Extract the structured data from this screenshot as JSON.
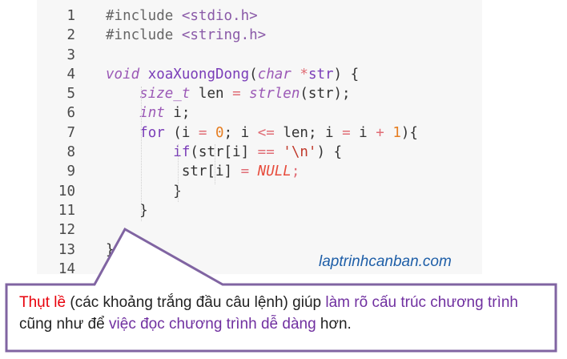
{
  "code_lines": [
    {
      "n": "1",
      "tokens": [
        {
          "t": "#include",
          "c": "dir"
        },
        {
          "t": " "
        },
        {
          "t": "<stdio.h>",
          "c": "inc"
        }
      ]
    },
    {
      "n": "2",
      "tokens": [
        {
          "t": "#include",
          "c": "dir"
        },
        {
          "t": " "
        },
        {
          "t": "<string.h>",
          "c": "inc"
        }
      ]
    },
    {
      "n": "3",
      "tokens": []
    },
    {
      "n": "4",
      "tokens": [
        {
          "t": "void",
          "c": "kw"
        },
        {
          "t": " "
        },
        {
          "t": "xoaXuongDong",
          "c": "fn"
        },
        {
          "t": "("
        },
        {
          "t": "char",
          "c": "kw"
        },
        {
          "t": " "
        },
        {
          "t": "*",
          "c": "op"
        },
        {
          "t": "str",
          "c": "fn"
        },
        {
          "t": ") {"
        }
      ]
    },
    {
      "n": "5",
      "tokens": [
        {
          "t": "    "
        },
        {
          "t": "size_t",
          "c": "kw"
        },
        {
          "t": " len "
        },
        {
          "t": "=",
          "c": "op"
        },
        {
          "t": " "
        },
        {
          "t": "strlen",
          "c": "kw"
        },
        {
          "t": "(str);"
        }
      ]
    },
    {
      "n": "6",
      "tokens": [
        {
          "t": "    "
        },
        {
          "t": "int",
          "c": "kw"
        },
        {
          "t": " i;"
        }
      ]
    },
    {
      "n": "7",
      "tokens": [
        {
          "t": "    "
        },
        {
          "t": "for",
          "c": "fn"
        },
        {
          "t": " (i "
        },
        {
          "t": "=",
          "c": "op"
        },
        {
          "t": " "
        },
        {
          "t": "0",
          "c": "num"
        },
        {
          "t": "; i "
        },
        {
          "t": "<=",
          "c": "op"
        },
        {
          "t": " len; i "
        },
        {
          "t": "=",
          "c": "op"
        },
        {
          "t": " i "
        },
        {
          "t": "+",
          "c": "op"
        },
        {
          "t": " "
        },
        {
          "t": "1",
          "c": "num"
        },
        {
          "t": "){"
        }
      ]
    },
    {
      "n": "8",
      "tokens": [
        {
          "t": "        "
        },
        {
          "t": "if",
          "c": "fn"
        },
        {
          "t": "(str[i] "
        },
        {
          "t": "==",
          "c": "op"
        },
        {
          "t": " "
        },
        {
          "t": "'\\n'",
          "c": "str"
        },
        {
          "t": ") {"
        }
      ]
    },
    {
      "n": "9",
      "tokens": [
        {
          "t": "         str[i] "
        },
        {
          "t": "=",
          "c": "op"
        },
        {
          "t": " "
        },
        {
          "t": "NULL",
          "c": "lit"
        },
        {
          "t": ";",
          "c": "op"
        }
      ]
    },
    {
      "n": "10",
      "tokens": [
        {
          "t": "        }"
        }
      ]
    },
    {
      "n": "11",
      "tokens": [
        {
          "t": "    }"
        }
      ]
    },
    {
      "n": "12",
      "tokens": []
    },
    {
      "n": "13",
      "tokens": [
        {
          "t": "}"
        }
      ]
    },
    {
      "n": "14",
      "tokens": []
    }
  ],
  "watermark": "laptrinhcanban.com",
  "callout": {
    "segments": [
      {
        "t": "Thụt lề",
        "c": "red"
      },
      {
        "t": " (các khoảng trắng đầu câu lệnh) giúp "
      },
      {
        "t": "làm rõ cấu trúc chương trình",
        "c": "purple"
      },
      {
        "t": " cũng như để "
      },
      {
        "t": "việc đọc chương trình dễ dàng",
        "c": "purple"
      },
      {
        "t": " hơn."
      }
    ]
  },
  "colors": {
    "highlight_red": "#e8000b",
    "highlight_purple": "#7030a0",
    "callout_border": "#8064a2",
    "watermark": "#1f5fa8"
  }
}
